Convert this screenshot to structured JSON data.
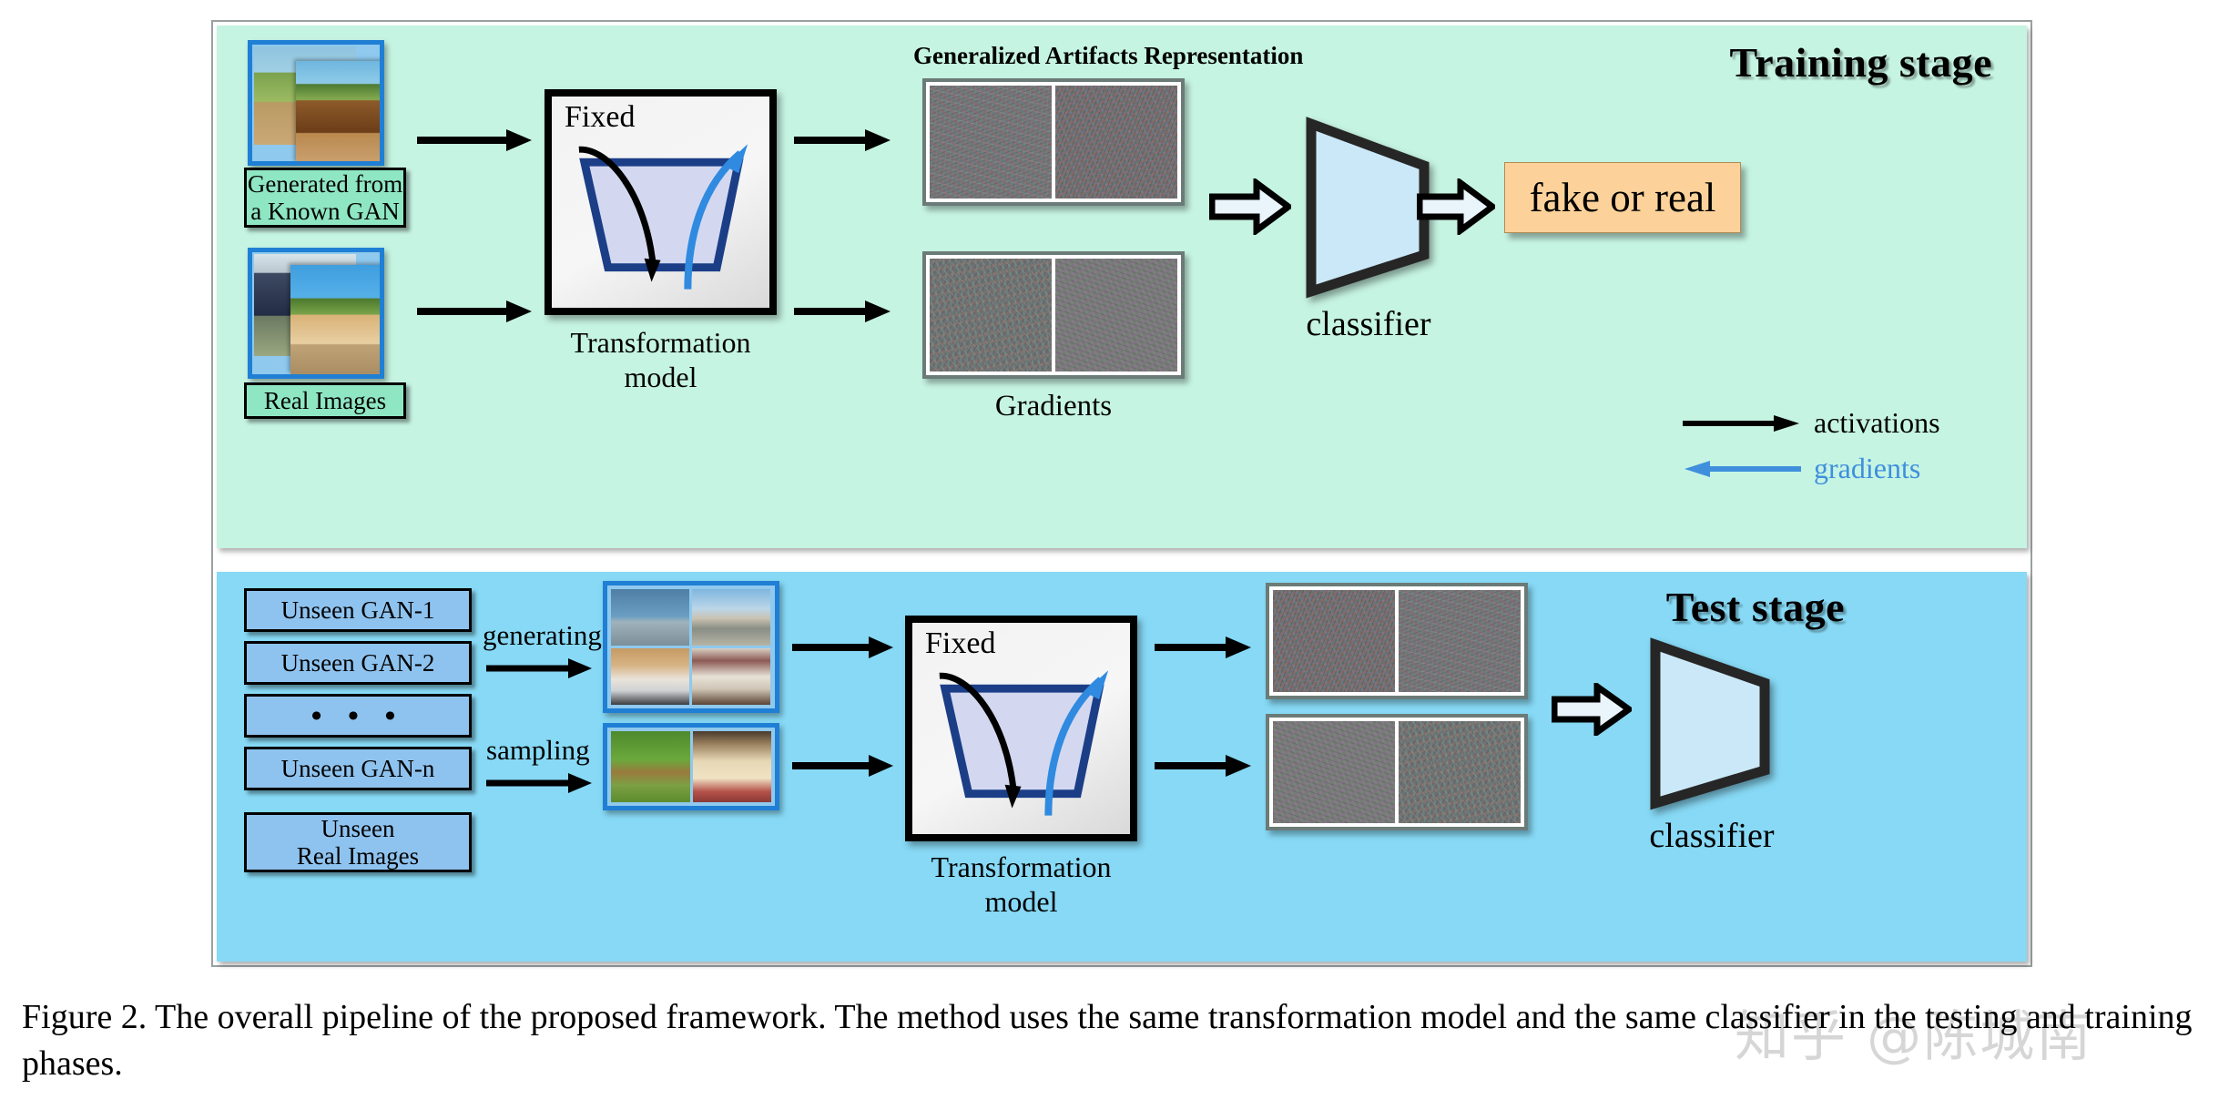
{
  "figure": {
    "caption": "Figure 2. The overall pipeline of the proposed framework. The method uses the same transformation model and the same classifier in the testing and training phases.",
    "watermark": "知乎 @陈城南"
  },
  "training_stage": {
    "title": "Training stage",
    "inputs": [
      {
        "label": "Generated from\na Known GAN"
      },
      {
        "label": "Real Images"
      }
    ],
    "transform": {
      "fixed_label": "Fixed",
      "caption": "Transformation\nmodel"
    },
    "representation": {
      "heading": "Generalized Artifacts Representation",
      "gradients_caption": "Gradients"
    },
    "classifier": {
      "caption": "classifier"
    },
    "output": {
      "label": "fake or real"
    },
    "legend": {
      "activations": "activations",
      "gradients": "gradients",
      "activations_color": "#000000",
      "gradients_color": "#3f8fdc"
    }
  },
  "test_stage": {
    "title": "Test stage",
    "sources": [
      {
        "label": "Unseen GAN-1"
      },
      {
        "label": "Unseen GAN-2"
      },
      {
        "label": "•  •  •"
      },
      {
        "label": "Unseen GAN-n"
      },
      {
        "label": "Unseen\nReal Images"
      }
    ],
    "flow_labels": {
      "generating": "generating",
      "sampling": "sampling"
    },
    "transform": {
      "fixed_label": "Fixed",
      "caption": "Transformation\nmodel"
    },
    "classifier": {
      "caption": "classifier"
    }
  },
  "colors": {
    "training_bg": "#c6f4e3",
    "test_bg": "#87d9f5",
    "plate_mint": "#8fe6c3",
    "plate_blue": "#8fc3ef",
    "classifier_fill": "#cbe8f8",
    "result_chip": "#fcd29a",
    "gradient_arrow": "#3f8fdc",
    "image_frame": "#1f7fd4"
  }
}
